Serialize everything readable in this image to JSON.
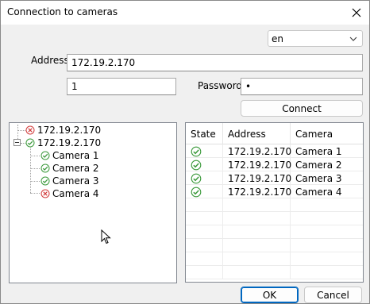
{
  "window": {
    "title": "Connection to cameras"
  },
  "language": {
    "value": "en"
  },
  "form": {
    "address_label": "Address",
    "address_value": "172.19.2.170",
    "user_value": "1",
    "password_label": "Password",
    "password_value": "•",
    "connect_label": "Connect"
  },
  "tree": {
    "nodes": [
      {
        "label": "172.19.2.170",
        "status": "error"
      },
      {
        "label": "172.19.2.170",
        "status": "ok",
        "expanded": true,
        "children": [
          {
            "label": "Camera 1",
            "status": "ok"
          },
          {
            "label": "Camera 2",
            "status": "ok"
          },
          {
            "label": "Camera 3",
            "status": "ok"
          },
          {
            "label": "Camera 4",
            "status": "error"
          }
        ]
      }
    ]
  },
  "table": {
    "columns": [
      "State",
      "Address",
      "Camera"
    ],
    "rows": [
      {
        "state": "ok",
        "address": "172.19.2.170",
        "camera": "Camera 1"
      },
      {
        "state": "ok",
        "address": "172.19.2.170",
        "camera": "Camera 2"
      },
      {
        "state": "ok",
        "address": "172.19.2.170",
        "camera": "Camera 3"
      },
      {
        "state": "ok",
        "address": "172.19.2.170",
        "camera": "Camera 4"
      }
    ]
  },
  "buttons": {
    "ok_label": "OK",
    "cancel_label": "Cancel"
  },
  "colors": {
    "ok": "#3c9a3c",
    "error": "#d23b3b",
    "accent": "#0067c0"
  }
}
